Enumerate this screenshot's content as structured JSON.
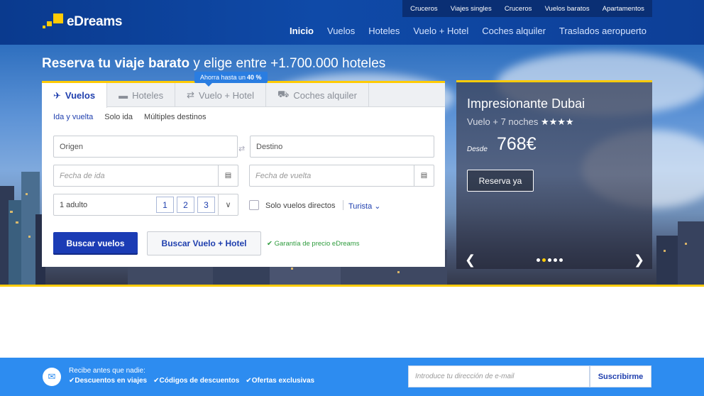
{
  "header": {
    "logo_text": "eDreams",
    "top_links": [
      "Cruceros",
      "Viajes singles",
      "Cruceros",
      "Vuelos baratos",
      "Apartamentos"
    ],
    "main_links": [
      "Inicio",
      "Vuelos",
      "Hoteles",
      "Vuelo + Hotel",
      "Coches alquiler",
      "Traslados aeropuerto"
    ]
  },
  "hero": {
    "headline_bold": "Reserva tu viaje barato",
    "headline_rest": " y elige entre +1.700.000 hoteles"
  },
  "search": {
    "promo_prefix": "Ahorra hasta un ",
    "promo_value": "40 %",
    "tabs": [
      "Vuelos",
      "Hoteles",
      "Vuelo + Hotel",
      "Coches alquiler"
    ],
    "trip_types": [
      "Ida y vuelta",
      "Solo ida",
      "Múltiples destinos"
    ],
    "origin_value": "Origen",
    "destination_value": "Destino",
    "departure_placeholder": "Fecha de ida",
    "return_placeholder": "Fecha de vuelta",
    "passengers_label": "1 adulto",
    "passenger_counts": [
      "1",
      "2",
      "3"
    ],
    "direct_flights_label": "Solo vuelos directos",
    "class_value": "Turista",
    "search_flights_label": "Buscar vuelos",
    "search_package_label": "Buscar Vuelo + Hotel",
    "guarantee_label": "Garantía de precio eDreams"
  },
  "promo_card": {
    "title": "Impresionante Dubai",
    "subtitle": "Vuelo + 7 noches",
    "stars": "★★★★",
    "price_prefix": "Desde",
    "price": "768€",
    "cta_label": "Reserva ya",
    "dot_count": 5,
    "active_dot": 1
  },
  "newsletter": {
    "title": "Recibe antes que nadie:",
    "items": [
      "Descuentos en viajes",
      "Códigos de descuentos",
      "Ofertas exclusivas"
    ],
    "email_placeholder": "Introduce tu dirección de e-mail",
    "subscribe_label": "Suscribirme"
  },
  "colors": {
    "brand_blue": "#0f4aa8",
    "accent_yellow": "#ffcb05",
    "button_blue": "#1b3cb5",
    "newsletter_blue": "#2d8cf0",
    "success_green": "#2d9b3c"
  }
}
